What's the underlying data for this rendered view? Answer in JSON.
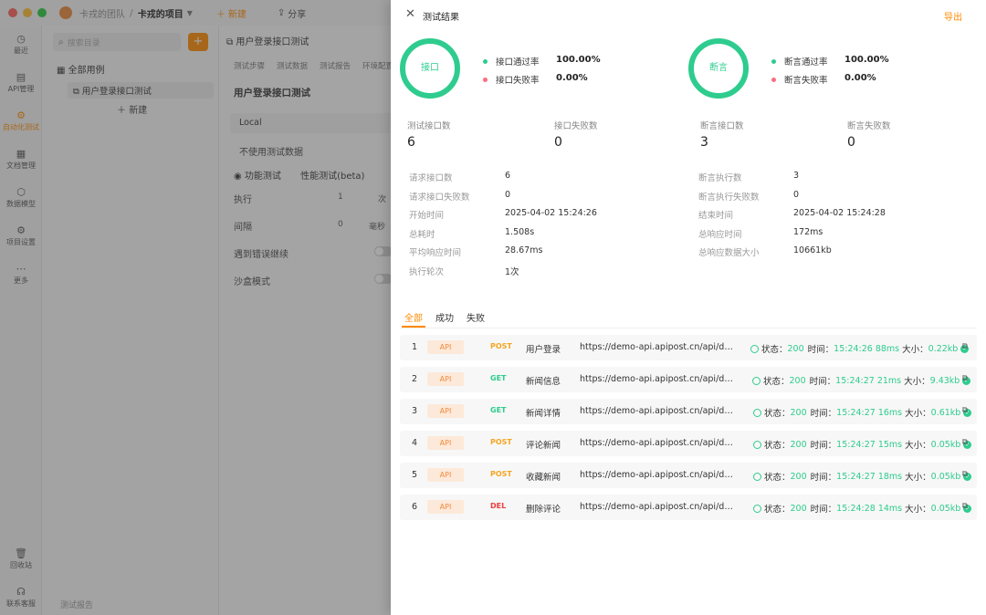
{
  "titlebar": {
    "team": "卡戎的团队",
    "project": "卡戎的项目",
    "new_label": "新建",
    "share_label": "分享"
  },
  "leftnav": [
    {
      "icon": "clock-icon",
      "label": "最近"
    },
    {
      "icon": "api-icon",
      "label": "API管理"
    },
    {
      "icon": "automation-icon",
      "label": "自动化测试"
    },
    {
      "icon": "document-icon",
      "label": "文档管理"
    },
    {
      "icon": "model-icon",
      "label": "数据模型"
    },
    {
      "icon": "settings-icon",
      "label": "项目设置"
    },
    {
      "icon": "more-icon",
      "label": "更多"
    },
    {
      "icon": "trash-icon",
      "label": "回收站"
    },
    {
      "icon": "headset-icon",
      "label": "联系客服"
    }
  ],
  "tree": {
    "search_placeholder": "搜索目录",
    "root": "全部用例",
    "child": "用户登录接口测试",
    "new_label": "新建",
    "footer": "测试报告"
  },
  "editor": {
    "tab": "用户登录接口测试",
    "subtabs": [
      "测试步骤",
      "测试数据",
      "测试报告",
      "环境配置"
    ],
    "title": "用户登录接口测试",
    "env": "Local",
    "no_data": "不使用测试数据",
    "mode_func": "功能测试",
    "mode_perf": "性能测试(beta)",
    "exec_label": "执行",
    "exec_val": "1",
    "exec_unit": "次",
    "interval_label": "间隔",
    "interval_val": "0",
    "interval_unit": "毫秒",
    "continue_on_error": "遇到错误继续",
    "sandbox": "沙盒模式"
  },
  "drawer": {
    "title": "测试结果",
    "export": "导出",
    "api_ring": "接口",
    "assert_ring": "断言",
    "api_pass_label": "接口通过率",
    "api_pass_val": "100.00%",
    "api_fail_label": "接口失败率",
    "api_fail_val": "0.00%",
    "assert_pass_label": "断言通过率",
    "assert_pass_val": "100.00%",
    "assert_fail_label": "断言失败率",
    "assert_fail_val": "0.00%",
    "stats": [
      {
        "label": "测试接口数",
        "value": "6"
      },
      {
        "label": "接口失败数",
        "value": "0"
      },
      {
        "label": "断言接口数",
        "value": "3"
      },
      {
        "label": "断言失败数",
        "value": "0"
      }
    ],
    "kv_left": [
      {
        "label": "请求接口数",
        "value": "6"
      },
      {
        "label": "请求接口失败数",
        "value": "0"
      },
      {
        "label": "开始时间",
        "value": "2025-04-02 15:24:26"
      },
      {
        "label": "总耗时",
        "value": "1.508s"
      },
      {
        "label": "平均响应时间",
        "value": "28.67ms"
      },
      {
        "label": "执行轮次",
        "value": "1次"
      }
    ],
    "kv_right": [
      {
        "label": "断言执行数",
        "value": "3"
      },
      {
        "label": "断言执行失败数",
        "value": "0"
      },
      {
        "label": "结束时间",
        "value": "2025-04-02 15:24:28"
      },
      {
        "label": "总响应时间",
        "value": "172ms"
      },
      {
        "label": "总响应数据大小",
        "value": "10661kb"
      }
    ],
    "tabs": [
      "全部",
      "成功",
      "失败"
    ],
    "status_label": "状态：",
    "time_label": "时间：",
    "size_label": "大小：",
    "rows": [
      {
        "idx": "1",
        "type": "API",
        "method": "POST",
        "name": "用户登录",
        "url": "https://demo-api.apipost.cn/api/demo/login",
        "status": "200",
        "time": "15:24:26",
        "duration": "88ms",
        "size": "0.22kb"
      },
      {
        "idx": "2",
        "type": "API",
        "method": "GET",
        "name": "新闻信息",
        "url": "https://demo-api.apipost.cn/api/demo/news_list",
        "status": "200",
        "time": "15:24:27",
        "duration": "21ms",
        "size": "9.43kb"
      },
      {
        "idx": "3",
        "type": "API",
        "method": "GET",
        "name": "新闻详情",
        "url": "https://demo-api.apipost.cn/api/demo/news_details",
        "status": "200",
        "time": "15:24:27",
        "duration": "16ms",
        "size": "0.61kb"
      },
      {
        "idx": "4",
        "type": "API",
        "method": "POST",
        "name": "评论新闻",
        "url": "https://demo-api.apipost.cn/api/demo/comment",
        "status": "200",
        "time": "15:24:27",
        "duration": "15ms",
        "size": "0.05kb"
      },
      {
        "idx": "5",
        "type": "API",
        "method": "POST",
        "name": "收藏新闻",
        "url": "https://demo-api.apipost.cn/api/demo/collect",
        "status": "200",
        "time": "15:24:27",
        "duration": "18ms",
        "size": "0.05kb"
      },
      {
        "idx": "6",
        "type": "API",
        "method": "DEL",
        "name": "删除评论",
        "url": "https://demo-api.apipost.cn/api/demo/delete",
        "status": "200",
        "time": "15:24:28",
        "duration": "14ms",
        "size": "0.05kb"
      }
    ]
  }
}
